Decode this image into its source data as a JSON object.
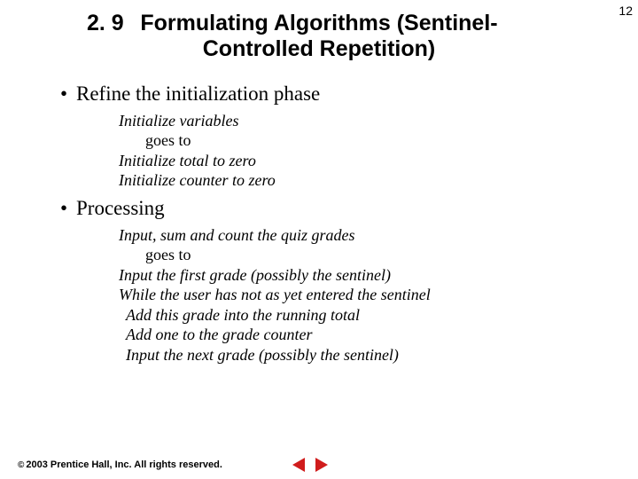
{
  "page_number": "12",
  "section_number": "2. 9",
  "section_title": "Formulating Algorithms (Sentinel-Controlled Repetition)",
  "bullets": {
    "b1": "Refine the initialization phase",
    "b2": "Processing"
  },
  "init": {
    "l1": "Initialize variables",
    "goes": "goes to",
    "l2": "Initialize total to zero",
    "l3": "Initialize counter to zero"
  },
  "proc": {
    "l1": "Input, sum and count the quiz grades",
    "goes": "goes to",
    "l2": "Input the first grade (possibly the sentinel)",
    "l3": "While the user has not as yet entered the sentinel",
    "l4": "Add this grade into the running total",
    "l5": "Add one to the grade counter",
    "l6": "Input the next grade (possibly the sentinel)"
  },
  "footer": {
    "copyright_symbol": "©",
    "text": "2003 Prentice Hall, Inc. All rights reserved."
  },
  "nav": {
    "prev": "previous",
    "next": "next"
  }
}
